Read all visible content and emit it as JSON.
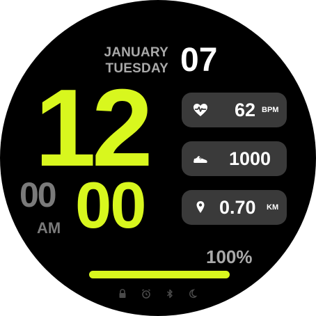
{
  "date": {
    "month": "JANUARY",
    "weekday": "TUESDAY",
    "day": "07"
  },
  "time": {
    "hour": "12",
    "minute": "00",
    "second": "00",
    "ampm": "AM"
  },
  "stats": {
    "heart": {
      "icon": "heart-rate-icon",
      "value": "62",
      "unit": "BPM"
    },
    "steps": {
      "icon": "shoe-icon",
      "value": "1000"
    },
    "distance": {
      "icon": "location-pin-icon",
      "value": "0.70",
      "unit": "KM"
    }
  },
  "battery": {
    "label": "100%",
    "level": 1.0
  },
  "status_icons": [
    "lock-icon",
    "alarm-icon",
    "bluetooth-icon",
    "moon-icon"
  ],
  "colors": {
    "accent": "#d8f71e",
    "card": "#3a3a3a",
    "muted": "#a9a9a9",
    "background": "#000000"
  }
}
